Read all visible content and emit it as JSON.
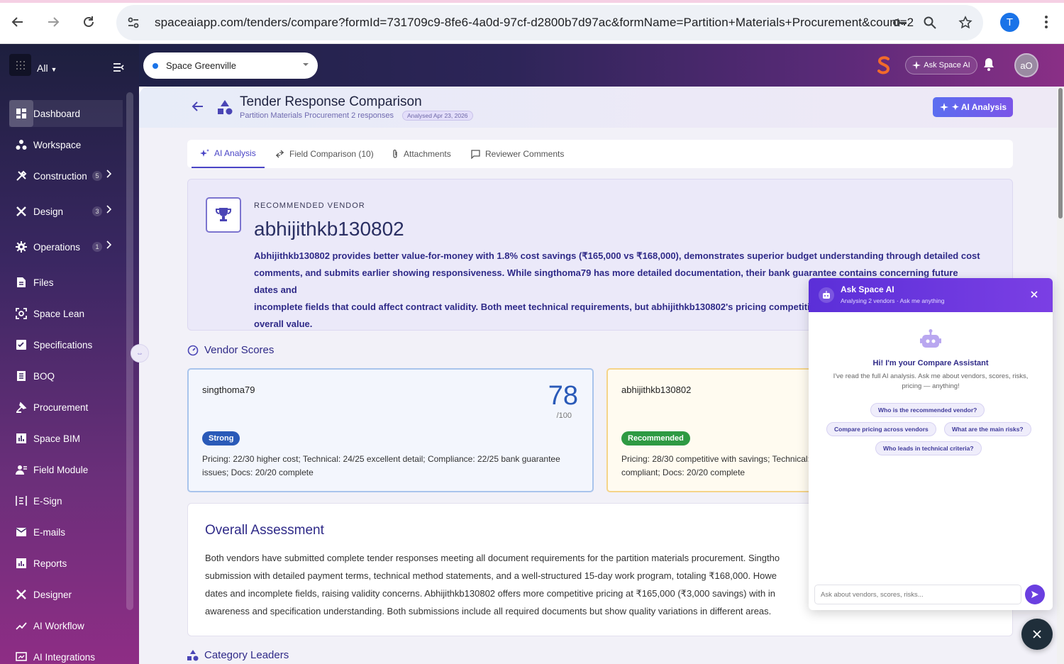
{
  "browser": {
    "url": "spaceaiapp.com/tenders/compare?formId=731709c9-8fe6-4a0d-97cf-d2800b7d97ac&formName=Partition+Materials+Procurement&count=2",
    "profile_initial": "T"
  },
  "sidebar": {
    "workspace_selector": "All",
    "items": [
      {
        "label": "Dashboard",
        "icon": "dashboard-icon",
        "active": true
      },
      {
        "label": "Workspace",
        "icon": "workspace-icon"
      },
      {
        "label": "Construction",
        "icon": "construction-icon",
        "count": "5"
      },
      {
        "label": "Design",
        "icon": "design-icon",
        "count": "3"
      },
      {
        "label": "Operations",
        "icon": "gear-icon",
        "count": "1"
      },
      {
        "label": "Files",
        "icon": "file-icon"
      },
      {
        "label": "Space Lean",
        "icon": "lean-icon"
      },
      {
        "label": "Specifications",
        "icon": "specifications-icon"
      },
      {
        "label": "BOQ",
        "icon": "boq-icon"
      },
      {
        "label": "Procurement",
        "icon": "procurement-icon"
      },
      {
        "label": "Space BIM",
        "icon": "bim-icon"
      },
      {
        "label": "Field Module",
        "icon": "field-icon"
      },
      {
        "label": "E-Sign",
        "icon": "esign-icon"
      },
      {
        "label": "E-mails",
        "icon": "mail-icon"
      },
      {
        "label": "Reports",
        "icon": "reports-icon"
      },
      {
        "label": "Designer",
        "icon": "designer-icon"
      },
      {
        "label": "AI Workflow",
        "icon": "workflow-icon"
      },
      {
        "label": "AI Integrations",
        "icon": "integrations-icon"
      }
    ]
  },
  "topbar": {
    "project": "Space Greenville",
    "ask_button": "Ask Space AI",
    "avatar_initials": "aO"
  },
  "page": {
    "title": "Tender Response Comparison",
    "subtitle": "Partition Materials Procurement 2 responses",
    "analysed_badge": "Analysed Apr 23, 2026",
    "ai_button": "✦ AI Analysis"
  },
  "tabs": [
    {
      "label": "AI Analysis",
      "active": true
    },
    {
      "label": "Field Comparison (10)"
    },
    {
      "label": "Attachments"
    },
    {
      "label": "Reviewer Comments"
    }
  ],
  "recommended": {
    "label": "RECOMMENDED VENDOR",
    "vendor": "abhijithkb130802",
    "lines": [
      "Abhijithkb130802 provides better value-for-money with 1.8% cost savings (₹165,000 vs ₹168,000), demonstrates superior budget understanding through detailed cost",
      "comments, and submits earlier showing responsiveness. While singthoma79 has more detailed documentation, their bank guarantee contains concerning future dates and",
      "incomplete fields that could affect contract validity. Both meet technical requirements, but abhijithkb130802's pricing competitiveness",
      "overall value."
    ]
  },
  "vendor_scores": {
    "title": "Vendor Scores",
    "vendors": [
      {
        "name": "singthoma79",
        "score": "78",
        "max": "/100",
        "badge": "Strong",
        "badge_color": "#2a5ab8",
        "lines": [
          "Pricing: 22/30 higher cost; Technical: 24/25 excellent detail; Compliance: 22/25 bank guarantee",
          "issues; Docs: 20/20 complete"
        ]
      },
      {
        "name": "abhijithkb130802",
        "score": "",
        "max": "",
        "badge": "Recommended",
        "badge_color": "#2e9a43",
        "lines": [
          "Pricing: 28/30 competitive with savings; Technical:",
          "compliant; Docs: 20/20 complete"
        ]
      }
    ]
  },
  "assessment": {
    "title": "Overall Assessment",
    "lines": [
      "Both vendors have submitted complete tender responses meeting all document requirements for the partition materials procurement. Singtho",
      "submission with detailed payment terms, technical method statements, and a well-structured 15-day work program, totaling ₹168,000. Howe",
      "dates and incomplete fields, raising validity concerns. Abhijithkb130802 offers more competitive pricing at ₹165,000 (₹3,000 savings) with in",
      "awareness and specification understanding. Both submissions include all required documents but show quality variations in different areas."
    ]
  },
  "category_leaders": {
    "title": "Category Leaders"
  },
  "chat": {
    "title": "Ask Space AI",
    "subtitle": "Analysing 2 vendors · Ask me anything",
    "greeting": "Hi! I'm your Compare Assistant",
    "intro_lines": [
      "I've read the full AI analysis. Ask me about vendors, scores, risks,",
      "pricing — anything!"
    ],
    "suggestions": [
      "Who is the recommended vendor?",
      "Compare pricing across vendors",
      "What are the main risks?",
      "Who leads in technical criteria?"
    ],
    "input_placeholder": "Ask about vendors, scores, risks..."
  },
  "colors": {
    "accent": "#4a45c6",
    "sidebar_top": "#1d1f3e",
    "sidebar_bottom": "#8e2d85",
    "chat_header": "#5b2fd8"
  }
}
